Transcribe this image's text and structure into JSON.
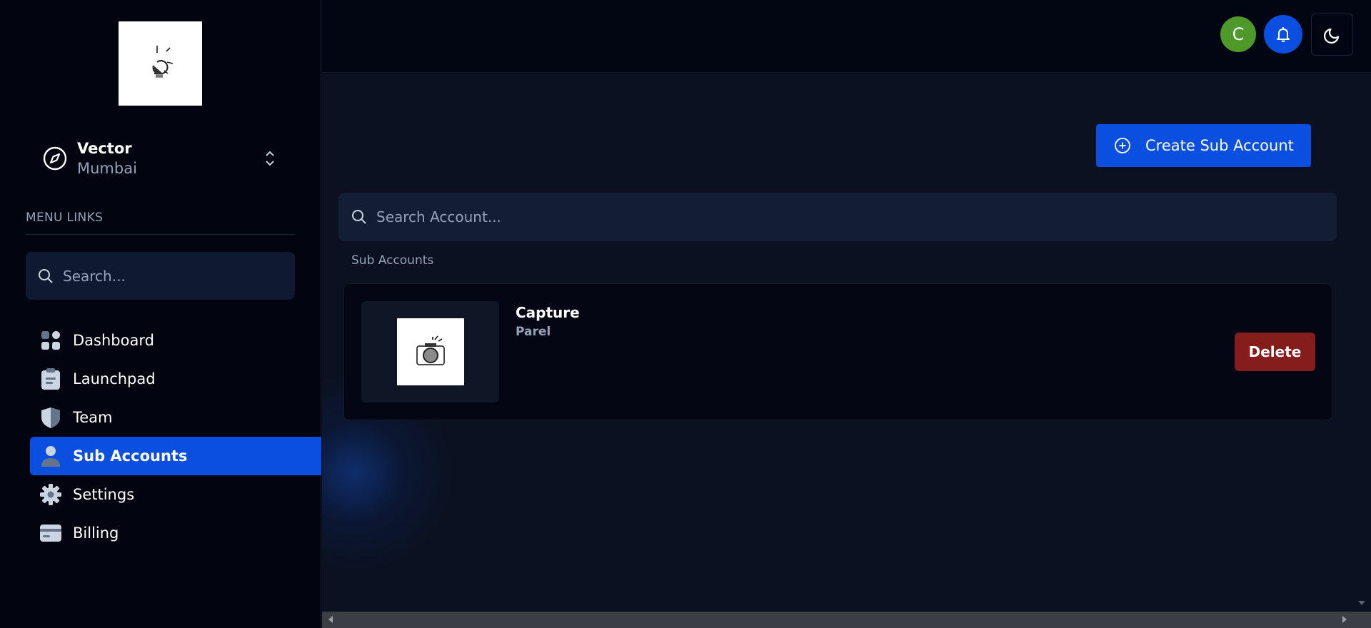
{
  "account": {
    "name": "Vector",
    "location": "Mumbai"
  },
  "sidebar": {
    "menu_label": "MENU LINKS",
    "search_placeholder": "Search...",
    "items": [
      {
        "label": "Dashboard",
        "icon": "dashboard-icon"
      },
      {
        "label": "Launchpad",
        "icon": "clipboard-icon"
      },
      {
        "label": "Team",
        "icon": "shield-icon"
      },
      {
        "label": "Sub Accounts",
        "icon": "person-icon",
        "active": true
      },
      {
        "label": "Settings",
        "icon": "gear-icon"
      },
      {
        "label": "Billing",
        "icon": "credit-card-icon"
      }
    ]
  },
  "topbar": {
    "avatar_initial": "C",
    "notifications_icon": "bell-icon",
    "theme_icon": "moon-icon"
  },
  "main": {
    "create_button": "Create Sub Account",
    "search_placeholder": "Search Account...",
    "section_label": "Sub Accounts",
    "sub_accounts": [
      {
        "name": "Capture",
        "location": "Parel",
        "delete_label": "Delete"
      }
    ]
  },
  "colors": {
    "accent": "#0a4fe0",
    "danger": "#861d1d",
    "avatar": "#4d9a2a",
    "background": "#020617"
  }
}
